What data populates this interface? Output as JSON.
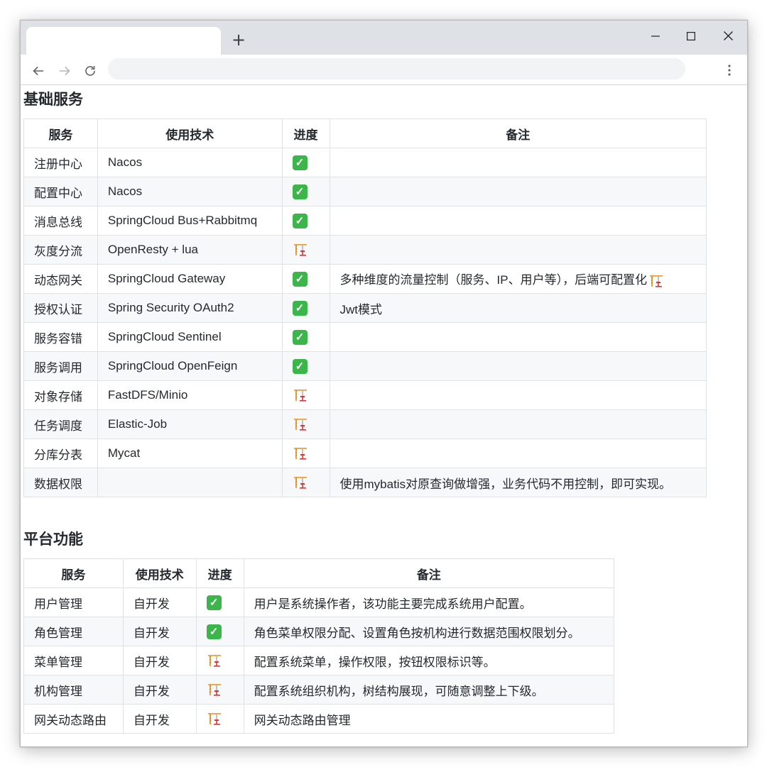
{
  "browser": {
    "new_tab_label": "+",
    "address_placeholder": ""
  },
  "colors": {
    "done": "#3cb54a",
    "table_border": "#dfe2e5",
    "stripe": "#f6f8fa",
    "text": "#24292e"
  },
  "icons": {
    "done": "white-check-mark-icon",
    "in_progress": "construction-crane-icon"
  },
  "sections": [
    {
      "title": "基础服务",
      "headers": [
        "服务",
        "使用技术",
        "进度",
        "备注"
      ],
      "rows": [
        {
          "service": "注册中心",
          "tech": "Nacos",
          "status": "done",
          "note": ""
        },
        {
          "service": "配置中心",
          "tech": "Nacos",
          "status": "done",
          "note": ""
        },
        {
          "service": "消息总线",
          "tech": "SpringCloud Bus+Rabbitmq",
          "status": "done",
          "note": ""
        },
        {
          "service": "灰度分流",
          "tech": "OpenResty + lua",
          "status": "in_progress",
          "note": ""
        },
        {
          "service": "动态网关",
          "tech": "SpringCloud Gateway",
          "status": "done",
          "note": "多种维度的流量控制（服务、IP、用户等），后端可配置化",
          "note_icon": "in_progress"
        },
        {
          "service": "授权认证",
          "tech": "Spring Security OAuth2",
          "status": "done",
          "note": "Jwt模式"
        },
        {
          "service": "服务容错",
          "tech": "SpringCloud Sentinel",
          "status": "done",
          "note": ""
        },
        {
          "service": "服务调用",
          "tech": "SpringCloud OpenFeign",
          "status": "done",
          "note": ""
        },
        {
          "service": "对象存储",
          "tech": "FastDFS/Minio",
          "status": "in_progress",
          "note": ""
        },
        {
          "service": "任务调度",
          "tech": "Elastic-Job",
          "status": "in_progress",
          "note": ""
        },
        {
          "service": "分库分表",
          "tech": "Mycat",
          "status": "in_progress",
          "note": ""
        },
        {
          "service": "数据权限",
          "tech": "",
          "status": "in_progress",
          "note": "使用mybatis对原查询做增强，业务代码不用控制，即可实现。"
        }
      ]
    },
    {
      "title": "平台功能",
      "headers": [
        "服务",
        "使用技术",
        "进度",
        "备注"
      ],
      "rows": [
        {
          "service": "用户管理",
          "tech": "自开发",
          "status": "done",
          "note": "用户是系统操作者，该功能主要完成系统用户配置。"
        },
        {
          "service": "角色管理",
          "tech": "自开发",
          "status": "done",
          "note": "角色菜单权限分配、设置角色按机构进行数据范围权限划分。"
        },
        {
          "service": "菜单管理",
          "tech": "自开发",
          "status": "in_progress",
          "note": "配置系统菜单，操作权限，按钮权限标识等。"
        },
        {
          "service": "机构管理",
          "tech": "自开发",
          "status": "in_progress",
          "note": "配置系统组织机构，树结构展现，可随意调整上下级。"
        },
        {
          "service": "网关动态路由",
          "tech": "自开发",
          "status": "in_progress",
          "note": "网关动态路由管理"
        }
      ]
    }
  ]
}
